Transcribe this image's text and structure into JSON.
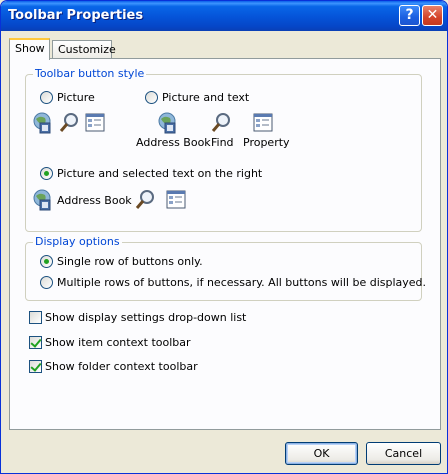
{
  "window": {
    "title": "Toolbar Properties"
  },
  "titlebar": {
    "help": "?",
    "close": "✕"
  },
  "tabs": [
    {
      "label": "Show",
      "active": true
    },
    {
      "label": "Customize",
      "active": false
    }
  ],
  "button_style": {
    "title": "Toolbar button style",
    "options": [
      {
        "label": "Picture",
        "selected": false
      },
      {
        "label": "Picture and text",
        "selected": false
      },
      {
        "label": "Picture and selected text on the right",
        "selected": true
      }
    ],
    "preview_text": {
      "address_book": "Address Book",
      "find": "Find",
      "property": "Property"
    },
    "right_preview": {
      "address_book": "Address Book"
    }
  },
  "display_options": {
    "title": "Display options",
    "options": [
      {
        "label": "Single row of buttons only.",
        "selected": true
      },
      {
        "label": "Multiple rows of buttons, if necessary.  All buttons will be displayed.",
        "selected": false
      }
    ]
  },
  "checkboxes": [
    {
      "label": "Show display settings drop-down list",
      "checked": false
    },
    {
      "label": "Show item context toolbar",
      "checked": true
    },
    {
      "label": "Show folder context toolbar",
      "checked": true
    }
  ],
  "footer": {
    "ok": "OK",
    "cancel": "Cancel"
  },
  "colors": {
    "accent": "#0046d5",
    "titlebar": "#0553d8",
    "check": "#21a121"
  }
}
